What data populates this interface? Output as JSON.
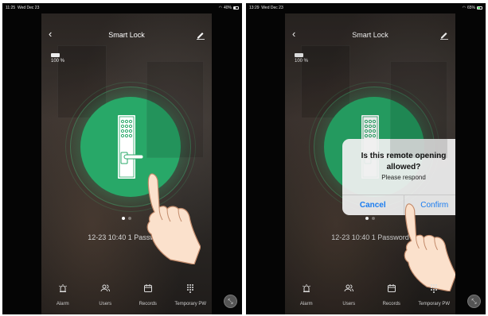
{
  "screens": [
    {
      "status": {
        "time": "11:25",
        "date": "Wed Dec 23",
        "battery": "40%"
      },
      "nav": {
        "back": "‹",
        "title": "Smart Lock"
      },
      "battery_label": "100 %",
      "last_record": "12-23 10:40  1 Password",
      "tabs": [
        {
          "label": "Alarm",
          "icon": "alarm-icon"
        },
        {
          "label": "Users",
          "icon": "users-icon"
        },
        {
          "label": "Records",
          "icon": "calendar-icon"
        },
        {
          "label": "Temporary PW",
          "icon": "keypad-icon"
        }
      ]
    },
    {
      "status": {
        "time": "13:29",
        "date": "Wed Dec 23",
        "battery": "65%"
      },
      "nav": {
        "back": "‹",
        "title": "Smart Lock"
      },
      "battery_label": "100 %",
      "last_record": "12-23 10:40  1 Password",
      "dialog": {
        "title": "Is this remote opening allowed?",
        "message": "Please respond",
        "cancel": "Cancel",
        "confirm": "Confirm"
      },
      "tabs": [
        {
          "label": "Alarm",
          "icon": "alarm-icon"
        },
        {
          "label": "Users",
          "icon": "users-icon"
        },
        {
          "label": "Records",
          "icon": "calendar-icon"
        },
        {
          "label": "Temporary PW",
          "icon": "keypad-icon"
        }
      ]
    }
  ],
  "colors": {
    "lock_green": "#28a868",
    "ios_blue": "#1a7cf0"
  }
}
